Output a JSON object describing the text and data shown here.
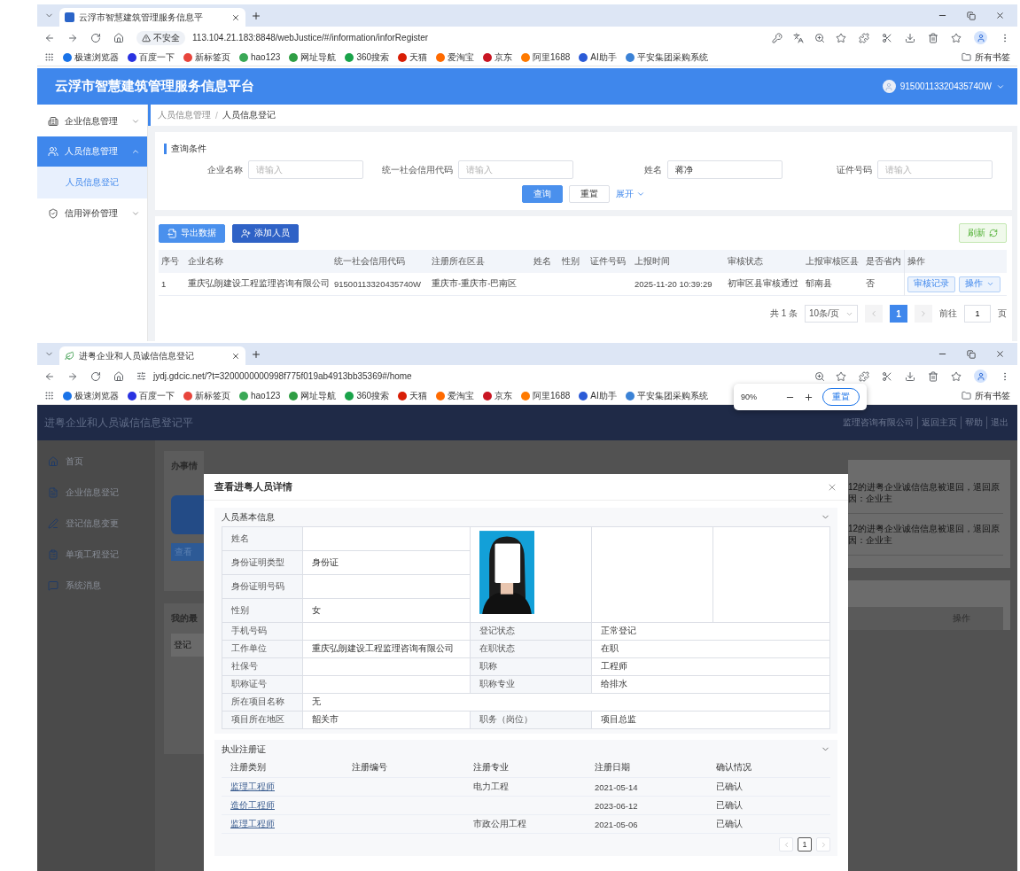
{
  "windows": [
    {
      "browser": {
        "tab_title": "云浮市智慧建筑管理服务信息平",
        "security": "不安全",
        "url": "113.104.21.183:8848/webJustice/#/information/inforRegister",
        "bookmarks": [
          {
            "label": "极速浏览器",
            "color": "#1a73e8"
          },
          {
            "label": "百度一下",
            "color": "#2932e1"
          },
          {
            "label": "新标签页",
            "color": "#e8453c"
          },
          {
            "label": "hao123",
            "color": "#3aa856"
          },
          {
            "label": "网址导航",
            "color": "#2f9e44"
          },
          {
            "label": "360搜索",
            "color": "#1aa34a"
          },
          {
            "label": "天猫",
            "color": "#d81e06"
          },
          {
            "label": "爱淘宝",
            "color": "#ff6a00"
          },
          {
            "label": "京东",
            "color": "#c91623"
          },
          {
            "label": "阿里1688",
            "color": "#ff7a00"
          },
          {
            "label": "AI助手",
            "color": "#2b5bd7"
          },
          {
            "label": "平安集团采购系统",
            "color": "#3b82d6"
          }
        ],
        "all_bookmarks": "所有书签"
      }
    },
    {
      "browser": {
        "tab_title": "进粤企业和人员诚信信息登记",
        "url": "jydj.gdcic.net/?t=3200000000998f775f019ab4913bb35369#/home",
        "bookmarks": [
          {
            "label": "极速浏览器",
            "color": "#1a73e8"
          },
          {
            "label": "百度一下",
            "color": "#2932e1"
          },
          {
            "label": "新标签页",
            "color": "#e8453c"
          },
          {
            "label": "hao123",
            "color": "#3aa856"
          },
          {
            "label": "网址导航",
            "color": "#2f9e44"
          },
          {
            "label": "360搜索",
            "color": "#1aa34a"
          },
          {
            "label": "天猫",
            "color": "#d81e06"
          },
          {
            "label": "爱淘宝",
            "color": "#ff6a00"
          },
          {
            "label": "京东",
            "color": "#c91623"
          },
          {
            "label": "阿里1688",
            "color": "#ff7a00"
          },
          {
            "label": "AI助手",
            "color": "#2b5bd7"
          },
          {
            "label": "平安集团采购系统",
            "color": "#3b82d6"
          }
        ],
        "all_bookmarks": "所有书签"
      },
      "zoom_popup": {
        "level": "90%",
        "reset": "重置"
      }
    }
  ],
  "app1": {
    "title": "云浮市智慧建筑管理服务信息平台",
    "user": "91500113320435740W",
    "sidebar": [
      {
        "label": "企业信息管理",
        "expanded": false,
        "selected": false
      },
      {
        "label": "人员信息管理",
        "expanded": true,
        "selected": true,
        "children": [
          {
            "label": "人员信息登记",
            "selected": true
          }
        ]
      },
      {
        "label": "信用评价管理",
        "expanded": false,
        "selected": false
      }
    ],
    "breadcrumb": [
      "人员信息管理",
      "人员信息登记"
    ],
    "breadcrumb_separator": "/",
    "query": {
      "title": "查询条件",
      "fields": [
        {
          "label": "企业名称",
          "placeholder": "请输入"
        },
        {
          "label": "统一社会信用代码",
          "placeholder": "请输入"
        },
        {
          "label": "姓名",
          "value": "蒋净"
        },
        {
          "label": "证件号码",
          "placeholder": "请输入"
        }
      ],
      "search": "查询",
      "reset": "重置",
      "expand": "展开"
    },
    "toolbar": {
      "export": "导出数据",
      "add": "添加人员",
      "refresh": "刷新"
    },
    "table": {
      "columns": [
        "序号",
        "企业名称",
        "统一社会信用代码",
        "注册所在区县",
        "姓名",
        "性别",
        "证件号码",
        "上报时间",
        "审核状态",
        "上报审核区县",
        "是否省内",
        "操作"
      ],
      "rows": [
        {
          "cells": [
            "1",
            "重庆弘朗建设工程监理咨询有限公司",
            "91500113320435740W",
            "重庆市-重庆市-巴南区",
            null,
            null,
            null,
            "2025-11-20 10:39:29",
            "初审区县审核通过",
            "郁南县",
            "否"
          ],
          "actions": [
            "审核记录",
            "操作"
          ]
        }
      ]
    },
    "pagination": {
      "total": "共 1 条",
      "page_size": "10条/页",
      "pages": [
        {
          "label": "1",
          "selected": true
        }
      ],
      "goto": "前往",
      "goto_value": "1",
      "unit": "页"
    }
  },
  "app2": {
    "title": "进粤企业和人员诚信信息登记平",
    "company": "监理咨询有限公司",
    "links": [
      "返回主页",
      "帮助",
      "退出"
    ],
    "sidebar": [
      "首页",
      "企业信息登记",
      "登记信息变更",
      "单项工程登记",
      "系统消息"
    ],
    "background": {
      "card_title": "办事情",
      "view_button": "查看",
      "recent_title": "我的最",
      "column_1": "登记",
      "messages": [
        "12的进粤企业诚信信息被退回，退回原因：企业主",
        "12的进粤企业诚信信息被退回，退回原因：企业主"
      ],
      "action_column": "操作"
    },
    "modal": {
      "title": "查看进粤人员详情",
      "basic": {
        "title": "人员基本信息",
        "expanded": true,
        "top_rows": [
          {
            "label": "姓名"
          },
          {
            "label": "身份证明类型",
            "value": "身份证"
          },
          {
            "label": "身份证明号码"
          },
          {
            "label": "性别",
            "value": "女"
          }
        ],
        "rows": [
          {
            "kind": "pair",
            "label": "手机号码",
            "label2": "登记状态",
            "value2": "正常登记"
          },
          {
            "kind": "pair",
            "label": "工作单位",
            "value": "重庆弘朗建设工程监理咨询有限公司",
            "label2": "在职状态",
            "value2": "在职"
          },
          {
            "kind": "pair",
            "label": "社保号",
            "label2": "职称",
            "value2": "工程师"
          },
          {
            "kind": "pair",
            "label": "职称证号",
            "label2": "职称专业",
            "value2": "给排水"
          },
          {
            "kind": "wide",
            "label": "所在项目名称",
            "value": "无"
          },
          {
            "kind": "pair",
            "label": "项目所在地区",
            "value": "韶关市",
            "label2": "职务（岗位）",
            "value2": "项目总监"
          }
        ]
      },
      "certificates": {
        "title": "执业注册证",
        "expanded": true,
        "columns": [
          "注册类别",
          "注册编号",
          "注册专业",
          "注册日期",
          "确认情况"
        ],
        "rows": [
          {
            "cells": [
              "监理工程师",
              null,
              "电力工程",
              "2021-05-14",
              "已确认"
            ]
          },
          {
            "cells": [
              "造价工程师",
              null,
              null,
              "2023-06-12",
              "已确认"
            ]
          },
          {
            "cells": [
              "监理工程师",
              null,
              "市政公用工程",
              "2021-05-06",
              "已确认"
            ]
          }
        ],
        "pages": [
          {
            "label": "1",
            "selected": true
          }
        ]
      }
    }
  }
}
